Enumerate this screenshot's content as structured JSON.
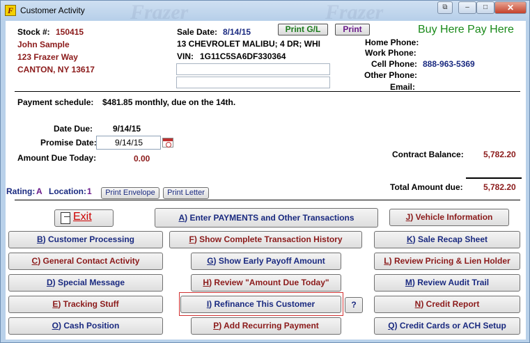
{
  "window": {
    "title": "Customer Activity",
    "watermark": "Frazer"
  },
  "customer": {
    "stock_label": "Stock #:",
    "stock_number": "150415",
    "name": "John Sample",
    "address": "123 Frazer Way",
    "city_state_zip": "CANTON, NY 13617"
  },
  "sale": {
    "sale_date_label": "Sale Date:",
    "sale_date": "8/14/15",
    "vehicle": "13 CHEVROLET MALIBU; 4 DR; WHI",
    "vin_label": "VIN:",
    "vin": "1G11C5SA6DF330364"
  },
  "header_buttons": {
    "print_gl": "Print G/L",
    "print": "Print"
  },
  "brand": {
    "slogan": "Buy Here Pay Here",
    "slogan_color": "#1a8a1a"
  },
  "phones": {
    "home_label": "Home Phone:",
    "work_label": "Work Phone:",
    "cell_label": "Cell Phone:",
    "cell_value": "888-963-5369",
    "other_label": "Other Phone:",
    "email_label": "Email:"
  },
  "schedule": {
    "label": "Payment schedule:",
    "value": "$481.85 monthly, due on the 14th."
  },
  "dates": {
    "date_due_label": "Date Due:",
    "date_due": "9/14/15",
    "promise_label": "Promise Date:",
    "promise_date": "9/14/15",
    "amount_due_label": "Amount Due Today:",
    "amount_due": "0.00"
  },
  "balance": {
    "contract_label": "Contract Balance:",
    "contract_value": "5,782.20",
    "total_label": "Total Amount due:",
    "total_value": "5,782.20"
  },
  "rating": {
    "rating_label": "Rating:",
    "rating_value": "A",
    "location_label": "Location:",
    "location_value": "1",
    "print_envelope": "Print Envelope",
    "print_letter": "Print Letter"
  },
  "actions": {
    "exit": "Exit",
    "a_key": "A",
    "a_rest": ") Enter PAYMENTS and Other Transactions",
    "j_key": "J",
    "j_rest": ") Vehicle Information",
    "b_key": "B",
    "b_rest": ") Customer Processing",
    "f_key": "F",
    "f_rest": ") Show Complete Transaction History",
    "k_key": "K",
    "k_rest": ") Sale Recap Sheet",
    "c_key": "C",
    "c_rest": ") General Contact Activity",
    "g_key": "G",
    "g_rest": ") Show Early Payoff Amount",
    "l_key": "L",
    "l_rest": ") Review Pricing & Lien Holder",
    "d_key": "D",
    "d_rest": ") Special Message",
    "h_key": "H",
    "h_rest": ") Review \"Amount Due Today\"",
    "m_key": "M",
    "m_rest": ") Review Audit Trail",
    "e_key": "E",
    "e_rest": ") Tracking Stuff",
    "i_key": "I",
    "i_rest": ") Refinance This Customer",
    "help": "?",
    "n_key": "N",
    "n_rest": ") Credit Report",
    "o_key": "O",
    "o_rest": ") Cash Position",
    "p_key": "P",
    "p_rest": ") Add Recurring Payment",
    "q_key": "Q",
    "q_rest": ") Credit Cards or ACH Setup"
  }
}
